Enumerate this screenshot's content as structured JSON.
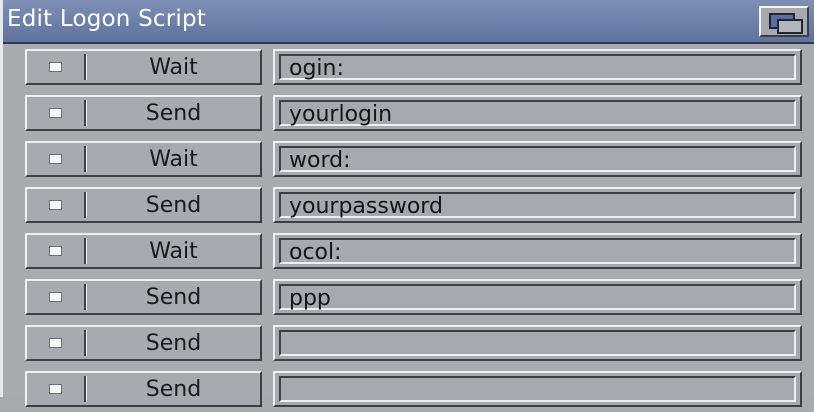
{
  "window": {
    "title": "Edit Logon Script"
  },
  "rows": [
    {
      "command": "Wait",
      "value": "ogin:"
    },
    {
      "command": "Send",
      "value": "yourlogin"
    },
    {
      "command": "Wait",
      "value": "word:"
    },
    {
      "command": "Send",
      "value": "yourpassword"
    },
    {
      "command": "Wait",
      "value": "ocol:"
    },
    {
      "command": "Send",
      "value": "ppp"
    },
    {
      "command": "Send",
      "value": ""
    },
    {
      "command": "Send",
      "value": ""
    }
  ],
  "icons": {
    "depth_gadget": "window-depth-icon",
    "cycle": "cycle-icon"
  },
  "colors": {
    "titlebar": "#6b7faa",
    "panel": "#a9abaf"
  }
}
